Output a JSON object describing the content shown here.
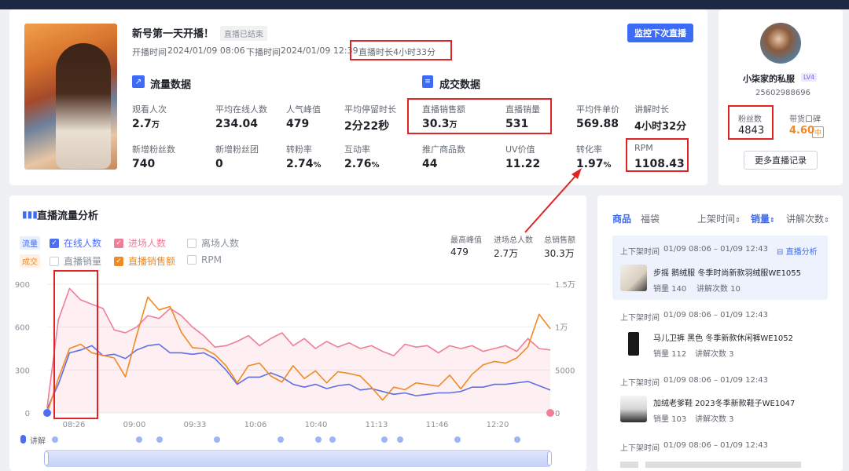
{
  "live": {
    "title": "新号第一天开播！",
    "status": "直播已结束",
    "start_label": "开播时间",
    "start_time": "2024/01/09 08:06",
    "end_label": "下播时间",
    "end_time": "2024/01/09 12:39",
    "duration_label": "直播时长",
    "duration": "4小时33分",
    "monitor_button": "监控下次直播"
  },
  "traffic": {
    "title": "流量数据",
    "metrics": [
      {
        "label": "观看人次",
        "value": "2.7",
        "unit": "万"
      },
      {
        "label": "平均在线人数",
        "value": "234.04",
        "unit": ""
      },
      {
        "label": "人气峰值",
        "value": "479",
        "unit": ""
      },
      {
        "label": "平均停留时长",
        "value": "2分22秒",
        "unit": ""
      },
      {
        "label": "新增粉丝数",
        "value": "740",
        "unit": ""
      },
      {
        "label": "新增粉丝团",
        "value": "0",
        "unit": ""
      },
      {
        "label": "转粉率",
        "value": "2.74",
        "unit": "%"
      },
      {
        "label": "互动率",
        "value": "2.76",
        "unit": "%"
      }
    ]
  },
  "deal": {
    "title": "成交数据",
    "metrics": [
      {
        "label": "直播销售额",
        "value": "30.3",
        "unit": "万"
      },
      {
        "label": "直播销量",
        "value": "531",
        "unit": ""
      },
      {
        "label": "平均件单价",
        "value": "569.88",
        "unit": ""
      },
      {
        "label": "讲解时长",
        "value": "4小时32分",
        "unit": ""
      },
      {
        "label": "推广商品数",
        "value": "44",
        "unit": ""
      },
      {
        "label": "UV价值",
        "value": "11.22",
        "unit": ""
      },
      {
        "label": "转化率",
        "value": "1.97",
        "unit": "%"
      },
      {
        "label": "RPM",
        "value": "1108.43",
        "unit": ""
      }
    ]
  },
  "profile": {
    "name": "小柒家的私服",
    "level": "LV4",
    "id": "25602988696",
    "fans_label": "粉丝数",
    "fans": "4843",
    "reputation_label": "带货口碑",
    "reputation": "4.60",
    "reputation_tag": "中",
    "more_button": "更多直播记录"
  },
  "analysis": {
    "title": "直播流量分析",
    "group_traffic": "流量",
    "group_deal": "成交",
    "legend": [
      "在线人数",
      "进场人数",
      "离场人数",
      "直播销量",
      "直播销售额",
      "RPM"
    ],
    "summary": [
      {
        "label": "最高峰值",
        "value": "479"
      },
      {
        "label": "进场总人数",
        "value": "2.7万"
      },
      {
        "label": "总销售额",
        "value": "30.3万"
      }
    ],
    "explain_label": "讲解"
  },
  "chart_data": {
    "type": "line",
    "x": [
      "08:06",
      "08:12",
      "08:18",
      "08:24",
      "08:30",
      "08:36",
      "08:42",
      "08:48",
      "08:54",
      "09:00",
      "09:06",
      "09:12",
      "09:18",
      "09:24",
      "09:30",
      "09:36",
      "09:42",
      "09:48",
      "09:54",
      "10:00",
      "10:06",
      "10:12",
      "10:18",
      "10:24",
      "10:30",
      "10:36",
      "10:42",
      "10:48",
      "10:54",
      "11:00",
      "11:06",
      "11:12",
      "11:18",
      "11:24",
      "11:30",
      "11:36",
      "11:42",
      "11:48",
      "11:54",
      "12:00",
      "12:06",
      "12:12",
      "12:18",
      "12:24",
      "12:30",
      "12:39"
    ],
    "x_tick_labels": [
      "08:26",
      "09:00",
      "09:33",
      "10:06",
      "10:40",
      "11:13",
      "11:46",
      "12:20"
    ],
    "y_left_ticks": [
      "0",
      "300",
      "600",
      "900"
    ],
    "y_right_ticks": [
      "0",
      "5000",
      "1万",
      "1.5万"
    ],
    "ylim_left": [
      0,
      900
    ],
    "ylim_right": [
      0,
      15000
    ],
    "series": [
      {
        "name": "在线人数",
        "axis": "left",
        "color": "#4e6ef2",
        "values": [
          30,
          200,
          420,
          440,
          470,
          400,
          410,
          380,
          440,
          470,
          480,
          420,
          420,
          410,
          420,
          380,
          300,
          200,
          250,
          250,
          280,
          250,
          200,
          180,
          200,
          170,
          190,
          200,
          160,
          170,
          150,
          130,
          140,
          120,
          130,
          140,
          140,
          150,
          180,
          180,
          200,
          200,
          210,
          220,
          190,
          160
        ]
      },
      {
        "name": "进场人数",
        "axis": "left",
        "color": "#ef7e96",
        "values": [
          40,
          650,
          870,
          790,
          760,
          730,
          580,
          560,
          600,
          680,
          660,
          730,
          680,
          600,
          540,
          460,
          470,
          500,
          540,
          470,
          520,
          560,
          470,
          520,
          450,
          500,
          460,
          490,
          450,
          470,
          430,
          400,
          480,
          460,
          470,
          420,
          470,
          450,
          470,
          430,
          450,
          470,
          430,
          520,
          450,
          440
        ]
      },
      {
        "name": "直播销售额",
        "axis": "right",
        "color": "#f08a24",
        "values": [
          0,
          4000,
          7500,
          8000,
          7000,
          6700,
          6400,
          4200,
          9000,
          13500,
          12000,
          12400,
          9400,
          7600,
          7500,
          6800,
          5500,
          3500,
          5500,
          5800,
          4300,
          3600,
          5500,
          4000,
          4900,
          3500,
          4800,
          4600,
          4300,
          3000,
          1500,
          3000,
          2700,
          3500,
          3300,
          3100,
          4400,
          2800,
          4500,
          5600,
          6000,
          5800,
          6400,
          7700,
          11500,
          9800
        ]
      }
    ]
  },
  "products": {
    "tabs": [
      "商品",
      "福袋"
    ],
    "sorts": [
      "上架时间",
      "销量",
      "讲解次数"
    ],
    "analysis_link": "直播分析",
    "items": [
      {
        "time_label": "上下架时间",
        "time": "01/09 08:06 – 01/09 12:43",
        "title": "步摇 鹅绒服 冬季时尚新款羽绒服WE1055",
        "sales": "销量 140",
        "explains": "讲解次数 10"
      },
      {
        "time_label": "上下架时间",
        "time": "01/09 08:06 – 01/09 12:43",
        "title": "马儿卫裤 黑色 冬季新款休闲裤WE1052",
        "sales": "销量 112",
        "explains": "讲解次数 3"
      },
      {
        "time_label": "上下架时间",
        "time": "01/09 08:06 – 01/09 12:43",
        "title": "加绒老爹鞋 2023冬季新款鞋子WE1047",
        "sales": "销量 103",
        "explains": "讲解次数 3"
      },
      {
        "time_label": "上下架时间",
        "time": "01/09 08:06 – 01/09 12:43",
        "title": "",
        "sales": "",
        "explains": ""
      }
    ]
  }
}
